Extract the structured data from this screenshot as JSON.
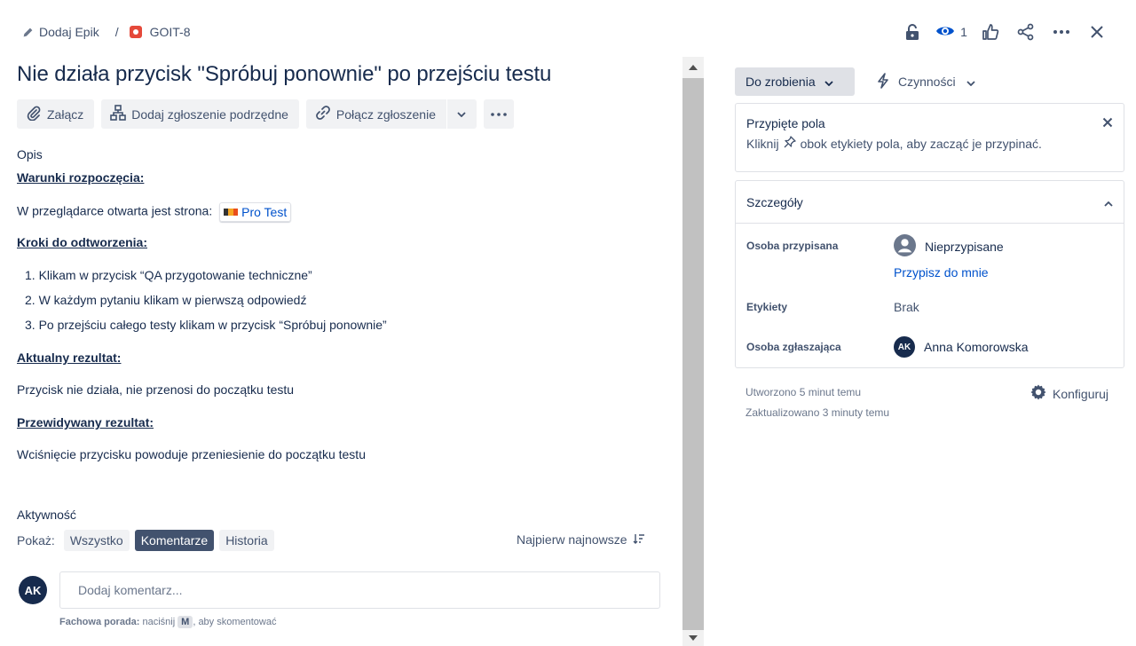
{
  "breadcrumb": {
    "epic_label": "Dodaj Epik",
    "separator": "/",
    "issue_key": "GOIT-8"
  },
  "header": {
    "watch_count": "1"
  },
  "issue": {
    "title": "Nie działa przycisk \"Spróbuj ponownie\" po przejściu testu",
    "toolbar": {
      "attach_label": "Załącz",
      "add_child_label": "Dodaj zgłoszenie podrzędne",
      "link_label": "Połącz zgłoszenie"
    },
    "description_label": "Opis",
    "preconditions_heading": "Warunki rozpoczęcia:",
    "preconditions_text": "W przeglądarce otwarta jest strona:",
    "smart_link": "Pro Test",
    "steps_heading": "Kroki do odtworzenia:",
    "steps": [
      "1. Klikam w przycisk “QA przygotowanie techniczne”",
      "2. W każdym pytaniu klikam w pierwszą odpowiedź",
      "3. Po przejściu całego testy klikam w przycisk “Spróbuj ponownie”"
    ],
    "actual_heading": "Aktualny rezultat:",
    "actual_text": "Przycisk nie działa, nie przenosi do początku testu",
    "expected_heading": "Przewidywany rezultat:",
    "expected_text": "Wciśnięcie przycisku powoduje przeniesienie do początku testu"
  },
  "activity": {
    "label": "Aktywność",
    "show_label": "Pokaż:",
    "filters": [
      "Wszystko",
      "Komentarze",
      "Historia"
    ],
    "active_filter": "Komentarze",
    "sort_label": "Najpierw najnowsze",
    "user_initials": "AK",
    "comment_placeholder": "Dodaj komentarz...",
    "tip_bold": "Fachowa porada:",
    "tip_pre": "naciśnij",
    "tip_key": "M",
    "tip_post": ", aby skomentować"
  },
  "sidebar": {
    "status_label": "Do zrobienia",
    "actions_label": "Czynności",
    "pinned": {
      "title": "Przypięte pola",
      "hint_pre": "Kliknij",
      "hint_post": "obok etykiety pola, aby zacząć je przypinać."
    },
    "details": {
      "title": "Szczegóły",
      "assignee_label": "Osoba przypisana",
      "assignee_value": "Nieprzypisane",
      "assign_to_me": "Przypisz do mnie",
      "labels_label": "Etykiety",
      "labels_value": "Brak",
      "reporter_label": "Osoba zgłaszająca",
      "reporter_initials": "AK",
      "reporter_value": "Anna Komorowska"
    },
    "created": "Utworzono 5 minut temu",
    "updated": "Zaktualizowano 3 minuty temu",
    "configure_label": "Konfiguruj"
  },
  "colors": {
    "primary_text": "#172b4d",
    "secondary_text": "#42526e",
    "link": "#0052cc",
    "bug": "#e5493a"
  }
}
